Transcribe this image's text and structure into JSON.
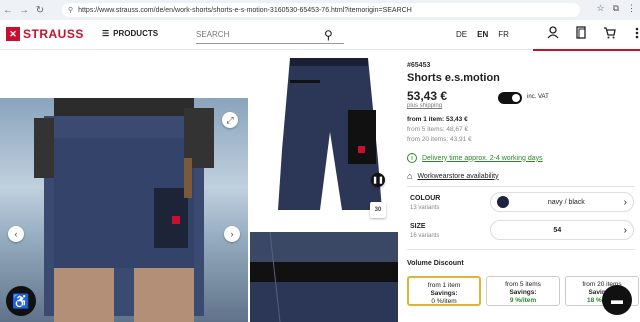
{
  "browser": {
    "url": "https://www.strauss.com/de/en/work-shorts/shorts-e-s-motion-3160530-65453-76.html?itemorigin=SEARCH"
  },
  "header": {
    "logo_text": "STRAUSS",
    "menu_label": "PRODUCTS",
    "search_placeholder": "SEARCH",
    "languages": [
      "DE",
      "EN",
      "FR"
    ],
    "active_language": "EN"
  },
  "product": {
    "article_no": "#65453",
    "title": "Shorts e.s.motion",
    "price": "53,43 €",
    "shipping_label": "plus shipping",
    "vat_label": "inc. VAT",
    "tiers": [
      "from 1 item: 53,43 €",
      "from 5 items: 48,67 €",
      "from 20 items: 43,91 €"
    ],
    "delivery_label": "Delivery time approx. 2-4 working days",
    "store_label": "Workwearstore availability"
  },
  "options": {
    "colour_label": "COLOUR",
    "colour_count": "13 variants",
    "colour_value": "navy / black",
    "colour_swatch": "#1b2340",
    "size_label": "SIZE",
    "size_count": "16 variants",
    "size_value": "54"
  },
  "volume": {
    "title": "Volume Discount",
    "cards": [
      {
        "from": "from 1 item",
        "savings": "Savings:",
        "pct": "0 %/item"
      },
      {
        "from": "from 5 items",
        "savings": "Savings:",
        "pct": "9 %/item"
      },
      {
        "from": "from 20 items",
        "savings": "Savings:",
        "pct": "18 %/item"
      }
    ]
  },
  "gallery": {
    "page_indicator": "30"
  },
  "colors": {
    "brand_red": "#c8102e",
    "success_green": "#2a8a2a"
  }
}
